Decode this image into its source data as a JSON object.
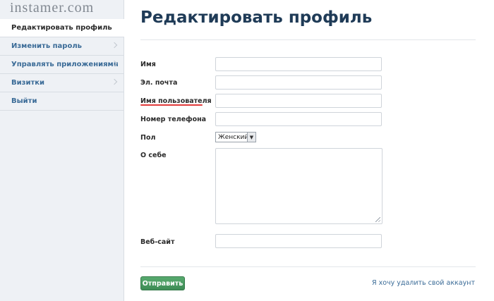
{
  "watermark": "instamer.com",
  "sidebar": {
    "items": [
      {
        "label": "Редактировать профиль",
        "active": true
      },
      {
        "label": "Изменить пароль"
      },
      {
        "label": "Управлять приложениями"
      },
      {
        "label": "Визитки"
      },
      {
        "label": "Выйти"
      }
    ]
  },
  "main": {
    "title": "Редактировать профиль",
    "fields": {
      "name_label": "Имя",
      "email_label": "Эл. почта",
      "username_label": "Имя пользователя",
      "phone_label": "Номер телефона",
      "gender_label": "Пол",
      "gender_value": "Женский",
      "bio_label": "О себе",
      "website_label": "Веб-сайт"
    },
    "submit_label": "Отправить",
    "delete_account_link": "Я хочу удалить свой аккаунт"
  },
  "colors": {
    "sidebar_bg": "#eef1f5",
    "link": "#3a6b97",
    "title": "#1f3b57",
    "submit_green": "#4a9a61",
    "spellcheck_underline": "#e23b3b"
  }
}
